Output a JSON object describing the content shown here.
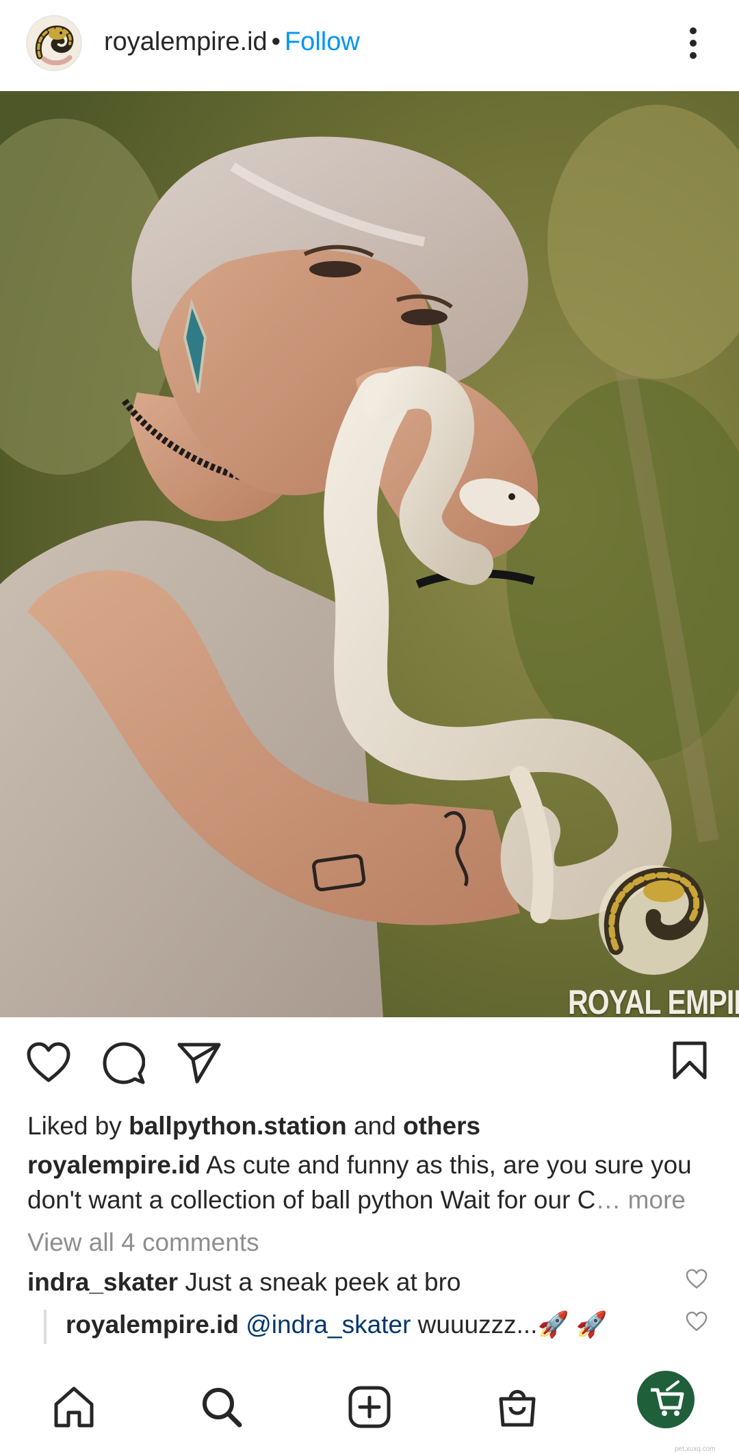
{
  "header": {
    "username": "royalempire.id",
    "separator": "•",
    "follow_label": "Follow",
    "more_icon": "more-vertical-icon"
  },
  "post": {
    "image_alt": "woman holding white ball python",
    "watermark": "ROYAL EMPIRE"
  },
  "actions": {
    "like_icon": "heart-icon",
    "comment_icon": "comment-icon",
    "share_icon": "send-icon",
    "save_icon": "bookmark-icon"
  },
  "likes": {
    "prefix": "Liked by ",
    "user": "ballpython.station",
    "middle": " and ",
    "others": "others"
  },
  "caption": {
    "username": "royalempire.id",
    "line1": " As cute and funny as this, are you sure you",
    "line2": "don't want a collection of ball python Wait for our C",
    "more": "… more"
  },
  "comments": {
    "view_all": "View all 4 comments",
    "items": [
      {
        "username": "indra_skater",
        "text": " Just a sneak peek at bro"
      }
    ],
    "reply": {
      "username": "royalempire.id",
      "mention": " @indra_skater",
      "text": " wuuuzzz...🚀 🚀"
    }
  },
  "nav": {
    "items": [
      "home-icon",
      "search-icon",
      "create-icon",
      "shop-icon",
      "profile-avatar"
    ]
  },
  "colors": {
    "follow": "#0095f6",
    "mention": "#00376b",
    "muted": "#8e8e8e",
    "text": "#262626",
    "badge": "#1f5f3a"
  },
  "credit": "pet.xuxq.com"
}
